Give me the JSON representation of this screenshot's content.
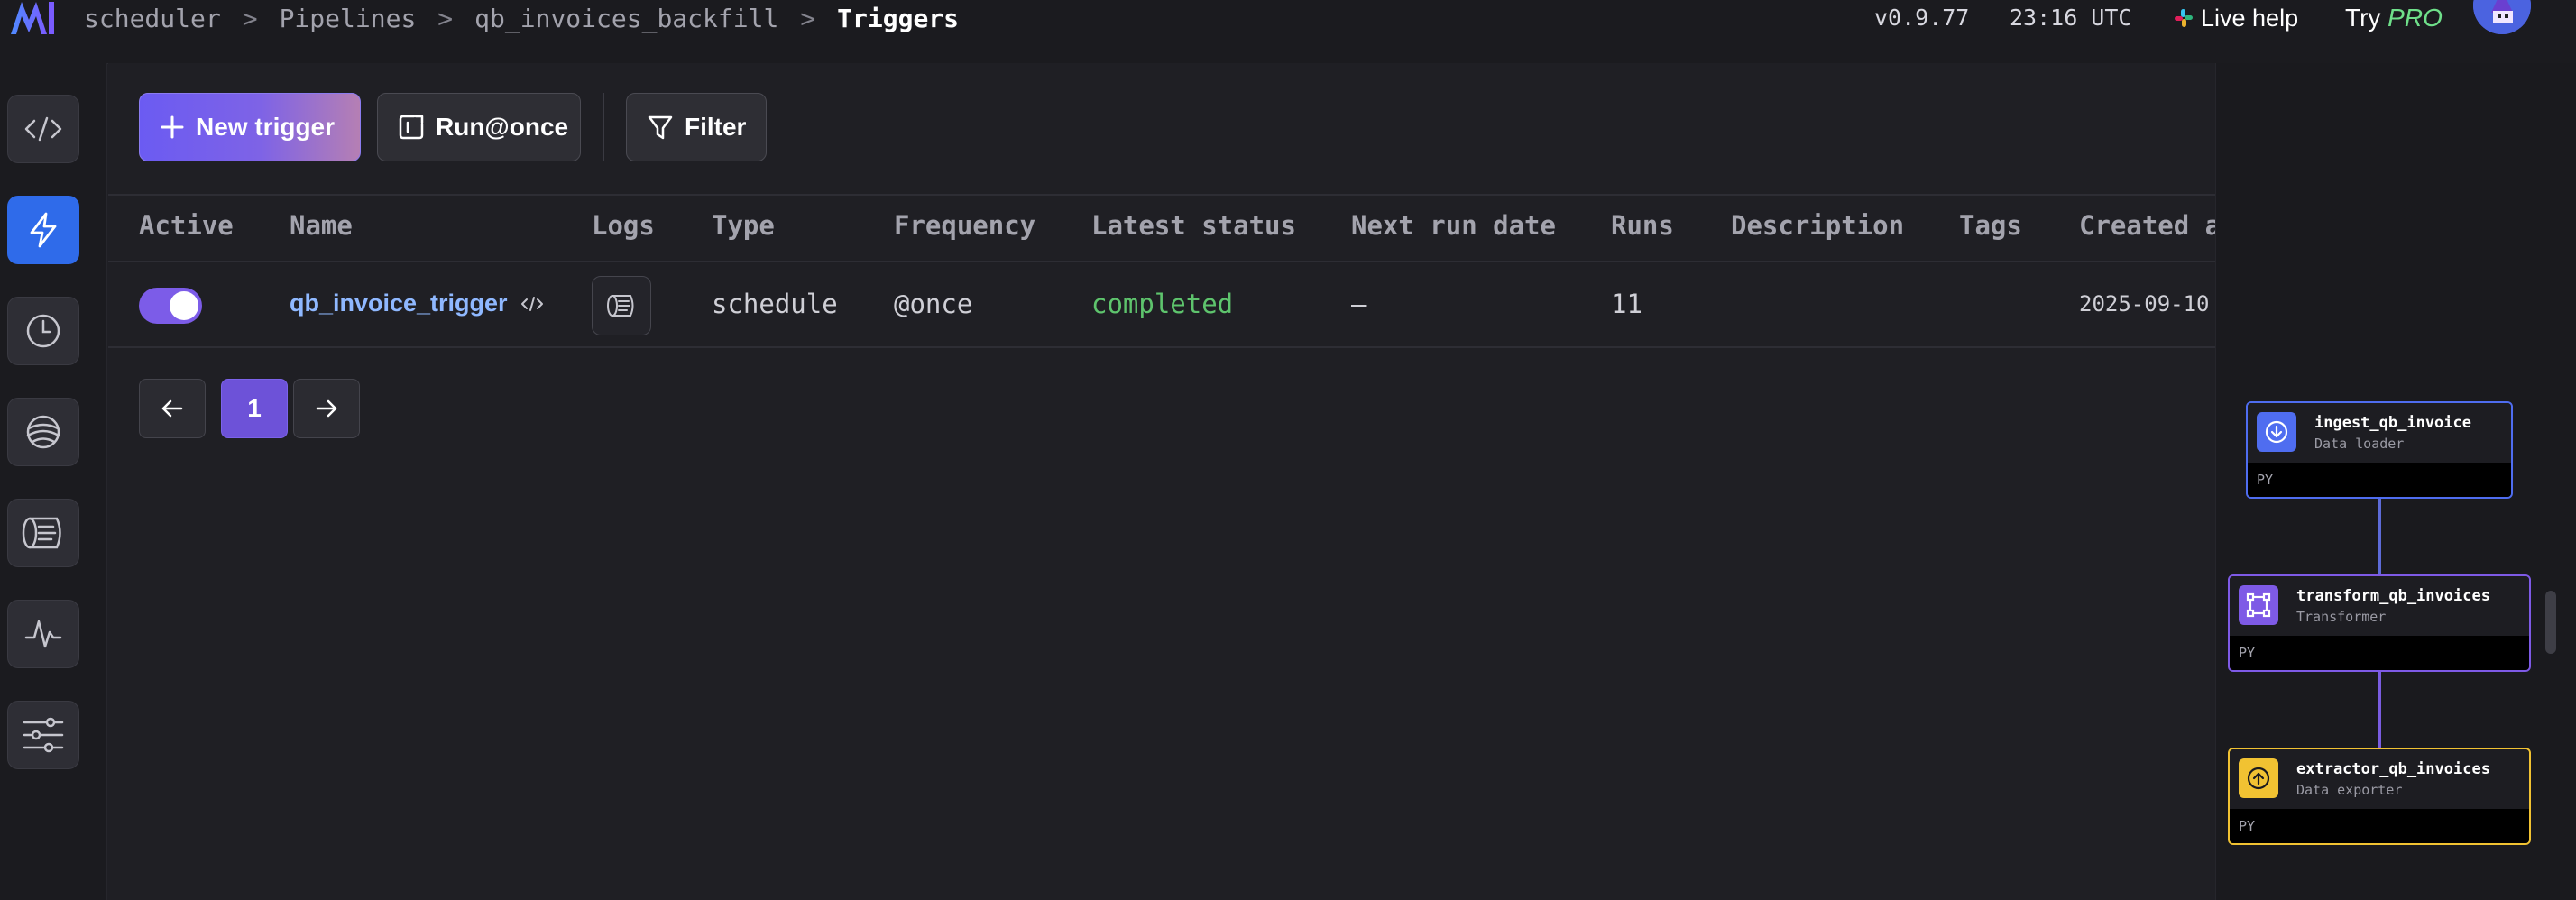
{
  "header": {
    "breadcrumbs": [
      "scheduler",
      "Pipelines",
      "qb_invoices_backfill"
    ],
    "separator": ">",
    "current": "Triggers",
    "version": "v0.9.77",
    "time": "23:16 UTC",
    "live_help": "Live help",
    "try_label": "Try",
    "pro_label": "PRO"
  },
  "sidebar": {
    "items": [
      {
        "icon": "code-icon",
        "active": false
      },
      {
        "icon": "lightning-icon",
        "active": true
      },
      {
        "icon": "clock-icon",
        "active": false
      },
      {
        "icon": "globe-icon",
        "active": false
      },
      {
        "icon": "logs-icon",
        "active": false
      },
      {
        "icon": "monitor-icon",
        "active": false
      },
      {
        "icon": "settings-sliders-icon",
        "active": false
      }
    ]
  },
  "toolbar": {
    "new_trigger": "New trigger",
    "run_once": "Run@once",
    "filter": "Filter"
  },
  "table": {
    "columns": [
      "Active",
      "Name",
      "Logs",
      "Type",
      "Frequency",
      "Latest status",
      "Next run date",
      "Runs",
      "Description",
      "Tags",
      "Created a"
    ],
    "rows": [
      {
        "active": true,
        "name": "qb_invoice_trigger",
        "type": "schedule",
        "frequency": "@once",
        "latest_status": "completed",
        "next_run_date": "–",
        "runs": "11",
        "description": "",
        "tags": "",
        "created_at": "2025-09-10"
      }
    ]
  },
  "pagination": {
    "current_page": "1"
  },
  "dependency_graph": {
    "blocks": [
      {
        "name": "ingest_qb_invoice",
        "kind": "Data loader",
        "lang": "PY",
        "color": "#4f6df0",
        "icon": "download-icon"
      },
      {
        "name": "transform_qb_invoices",
        "kind": "Transformer",
        "lang": "PY",
        "color": "#7e5ae6",
        "icon": "transform-icon"
      },
      {
        "name": "extractor_qb_invoices",
        "kind": "Data exporter",
        "lang": "PY",
        "color": "#f1c232",
        "icon": "upload-icon"
      }
    ]
  },
  "colors": {
    "accent": "#7c5ce8",
    "status_completed": "#5ec46d",
    "link": "#8fb8ff",
    "sidebar_active": "#2f6bea"
  }
}
